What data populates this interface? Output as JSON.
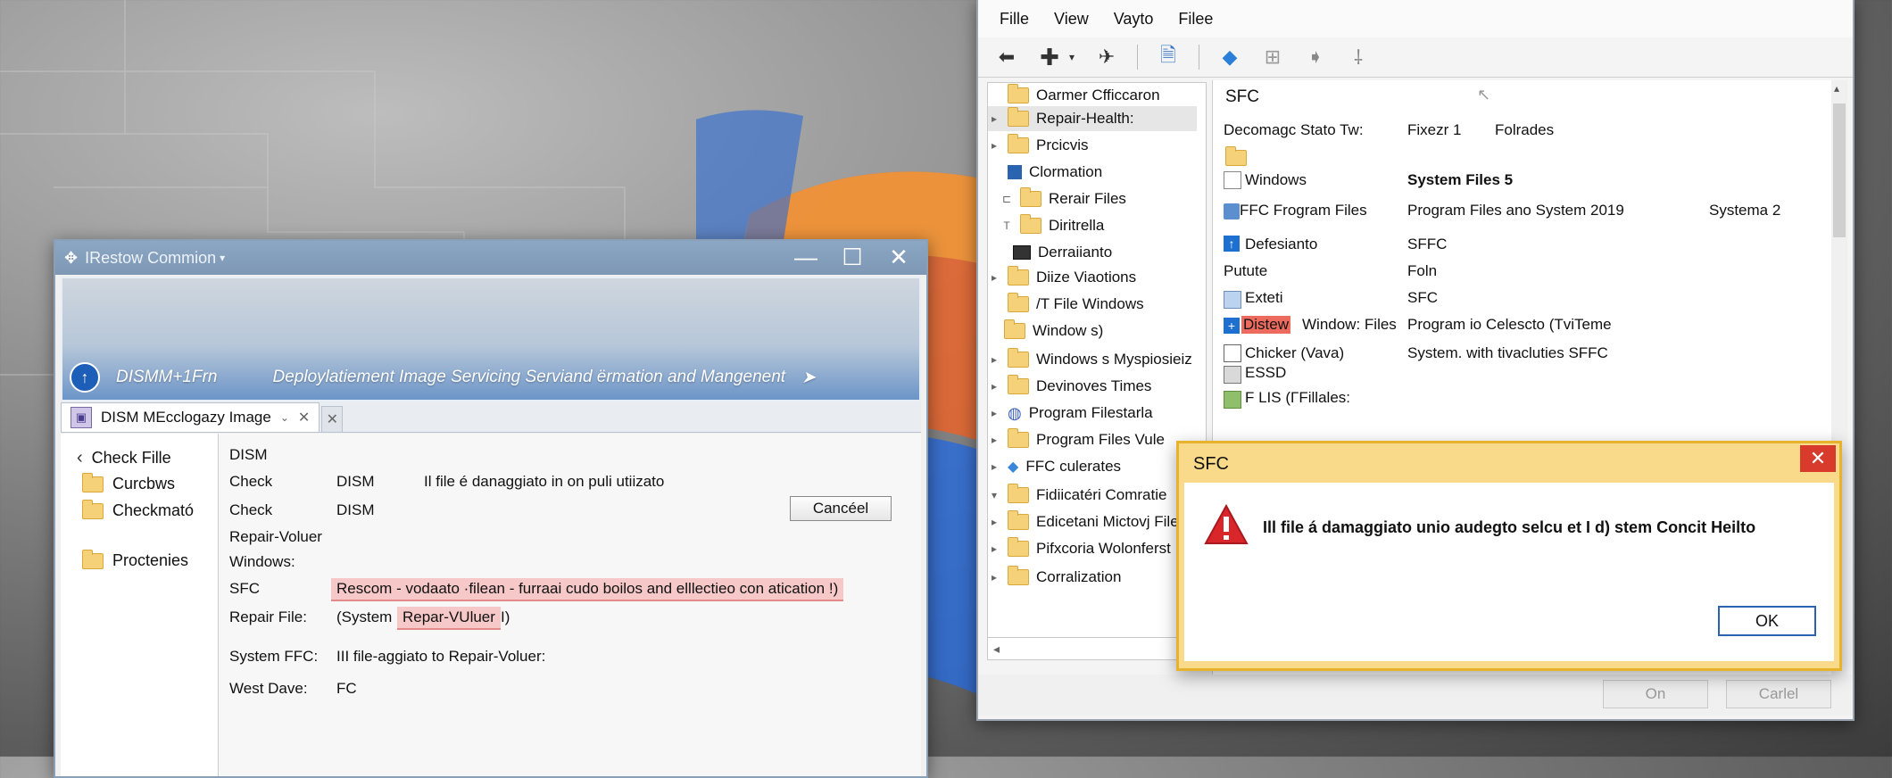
{
  "left_window": {
    "title": "IRestow Commion",
    "banner_short": "DISMM+1Frn",
    "banner_desc": "Deploylatiement Image Servicing Serviand ërmation and Mangenent",
    "banner_arrow": "➤",
    "tab_label": "DISM MEcclogazy Image",
    "nav": {
      "back_label": "Check Fille",
      "items": [
        "Curcbws",
        "Checkmató",
        "Proctenies"
      ]
    },
    "main": {
      "heading": "DISM",
      "rows": [
        {
          "label": "Check",
          "col2": "DISM",
          "col3": "Il file é danaggiato in on puli utiizato"
        },
        {
          "label": "Check",
          "col2": "DISM"
        },
        {
          "label": "Repair-Voluer"
        },
        {
          "label": "Windows:"
        },
        {
          "label": "SFC",
          "highlight": "Rescom - vodaato ·filean - furraai cudo boilos and elllectieo con atication !)"
        },
        {
          "label": "Repair File:",
          "prefix": "(System",
          "highlight": "Repar-VUluer",
          "suffix": "I)"
        },
        {
          "label": "System FFC:",
          "value": "III file-aggiato to Repair-Voluer:"
        },
        {
          "label": "West Dave:",
          "value": "FC"
        }
      ],
      "cancel_label": "Cancéel"
    }
  },
  "right_window": {
    "menu": [
      "Fille",
      "View",
      "Vayto",
      "Filee"
    ],
    "toolbar_icons": [
      "back-arrow-icon",
      "add-icon",
      "dropdown-icon",
      "pin-icon",
      "document-icon",
      "diamond-icon",
      "grid-icon",
      "tag-icon",
      "cursor-icon"
    ],
    "tree": [
      {
        "label": "Oarmer Cfficcaron",
        "icon": "folder"
      },
      {
        "label": "Repair-Health:",
        "icon": "folder",
        "selected": true
      },
      {
        "label": "Prcicvis",
        "icon": "folder"
      },
      {
        "label": "Clormation",
        "icon": "blue-square"
      },
      {
        "label": "Rerair Files",
        "icon": "folder",
        "prefix": "⊏"
      },
      {
        "label": "Diritrella",
        "icon": "folder",
        "prefix": "T"
      },
      {
        "label": "Derraiianto",
        "icon": "monitor"
      },
      {
        "label": "Diize Viaotions",
        "icon": "folder"
      },
      {
        "label": "/T File Windows",
        "icon": "folder"
      },
      {
        "label": "Window s)",
        "icon": "folder"
      },
      {
        "label": "Windows s Myspiosieiz",
        "icon": "folder"
      },
      {
        "label": "Devinoves Times",
        "icon": "folder"
      },
      {
        "label": "Program Filestarla",
        "icon": "globe"
      },
      {
        "label": "Program Files Vule",
        "icon": "gear"
      },
      {
        "label": "FFC culerates",
        "icon": "diamond"
      },
      {
        "label": "Fidiicatéri Comratie",
        "icon": "folder"
      },
      {
        "label": "Edicetani Mictovj File",
        "icon": "folder"
      },
      {
        "label": "Pifxcoria Wolonferst",
        "icon": "folder"
      },
      {
        "label": "Corralization",
        "icon": "folder"
      }
    ],
    "content": {
      "heading": "SFC",
      "header_row": [
        "Decomagc Stato Tw:",
        "Fixezr 1",
        "Folrades"
      ],
      "rows": [
        {
          "name": "Windows",
          "value": "System Files 5",
          "icon": "document",
          "bold_value": true
        },
        {
          "name": "FFC Frogram Files",
          "value": "Program Files ano System 2019",
          "extra": "Systema 2",
          "icon": "folder-blue"
        },
        {
          "name": "Defesianto",
          "value": "SFFC",
          "icon": "blue-arrow"
        },
        {
          "name": "Putute",
          "value": "Foln"
        },
        {
          "name": "Exteti",
          "value": "SFC",
          "icon": "folder-blue"
        },
        {
          "name": "Window: Files",
          "name_highlight": "Distew",
          "value": "Program io Celescto (TviTeme",
          "icon": "blue-plus"
        },
        {
          "name": "Chicker (Vava)",
          "value": "System. with tivacluties SFFC",
          "icon": "checkbox"
        },
        {
          "name": "ESSD",
          "icon": "disk"
        },
        {
          "name": "F LIS (ΓFillales:",
          "icon": "folder-green"
        }
      ]
    },
    "buttons": {
      "on": "On",
      "cancel": "Carlel"
    }
  },
  "dialog": {
    "title": "SFC",
    "message": "Ill file á damaggiato unio audegto selcu et I d) stem Concit Heilto",
    "ok_label": "OK"
  },
  "colors": {
    "dialog_border": "#e7b32d",
    "close_red": "#d83a2b",
    "highlight_pink": "#f6c8c8",
    "accent_blue": "#2a64b0"
  }
}
